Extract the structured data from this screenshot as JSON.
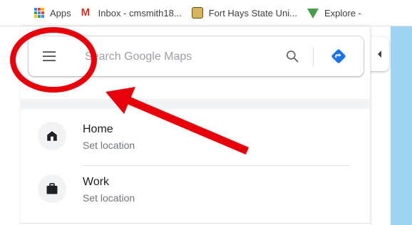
{
  "bookmarks": [
    {
      "label": "Apps",
      "icon": "apps-grid-icon"
    },
    {
      "label": "Inbox - cmsmith18...",
      "icon": "gmail-icon"
    },
    {
      "label": "Fort Hays State Uni...",
      "icon": "fhsu-icon"
    },
    {
      "label": "Explore -",
      "icon": "vidyard-icon"
    }
  ],
  "search": {
    "placeholder": "Search Google Maps"
  },
  "places": [
    {
      "title": "Home",
      "subtitle": "Set location",
      "icon": "home-icon"
    },
    {
      "title": "Work",
      "subtitle": "Set location",
      "icon": "briefcase-icon"
    }
  ],
  "colors": {
    "annotation_red": "#e8000b",
    "directions_blue": "#1a73e8",
    "map_water": "#9fd5f2"
  }
}
